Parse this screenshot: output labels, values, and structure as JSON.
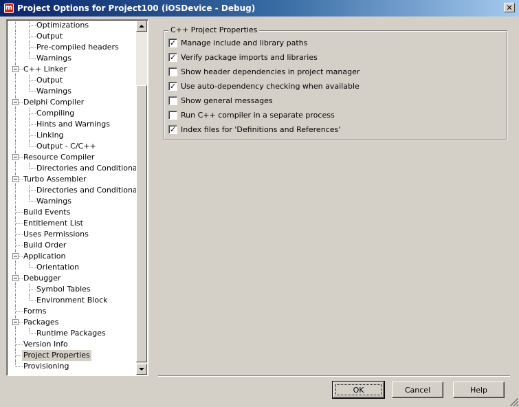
{
  "window": {
    "title": "Project Options for Project100  (iOSDevice - Debug)",
    "app_icon": "embarcadero-logo-icon",
    "close_glyph": "✕"
  },
  "tree": {
    "items": [
      {
        "label": "Optimizations",
        "level": 2,
        "expander": false
      },
      {
        "label": "Output",
        "level": 2,
        "expander": false
      },
      {
        "label": "Pre-compiled headers",
        "level": 2,
        "expander": false
      },
      {
        "label": "Warnings",
        "level": 2,
        "expander": false
      },
      {
        "label": "C++ Linker",
        "level": 1,
        "expander": true
      },
      {
        "label": "Output",
        "level": 2,
        "expander": false
      },
      {
        "label": "Warnings",
        "level": 2,
        "expander": false
      },
      {
        "label": "Delphi Compiler",
        "level": 1,
        "expander": true
      },
      {
        "label": "Compiling",
        "level": 2,
        "expander": false
      },
      {
        "label": "Hints and Warnings",
        "level": 2,
        "expander": false
      },
      {
        "label": "Linking",
        "level": 2,
        "expander": false
      },
      {
        "label": "Output - C/C++",
        "level": 2,
        "expander": false
      },
      {
        "label": "Resource Compiler",
        "level": 1,
        "expander": true
      },
      {
        "label": "Directories and Conditionals",
        "level": 2,
        "expander": false
      },
      {
        "label": "Turbo Assembler",
        "level": 1,
        "expander": true
      },
      {
        "label": "Directories and Conditionals",
        "level": 2,
        "expander": false
      },
      {
        "label": "Warnings",
        "level": 2,
        "expander": false
      },
      {
        "label": "Build Events",
        "level": 1,
        "expander": false
      },
      {
        "label": "Entitlement List",
        "level": 1,
        "expander": false
      },
      {
        "label": "Uses Permissions",
        "level": 1,
        "expander": false
      },
      {
        "label": "Build Order",
        "level": 1,
        "expander": false
      },
      {
        "label": "Application",
        "level": 1,
        "expander": true
      },
      {
        "label": "Orientation",
        "level": 2,
        "expander": false
      },
      {
        "label": "Debugger",
        "level": 1,
        "expander": true
      },
      {
        "label": "Symbol Tables",
        "level": 2,
        "expander": false
      },
      {
        "label": "Environment Block",
        "level": 2,
        "expander": false
      },
      {
        "label": "Forms",
        "level": 1,
        "expander": false
      },
      {
        "label": "Packages",
        "level": 1,
        "expander": true
      },
      {
        "label": "Runtime Packages",
        "level": 2,
        "expander": false
      },
      {
        "label": "Version Info",
        "level": 1,
        "expander": false
      },
      {
        "label": "Project Properties",
        "level": 1,
        "expander": false,
        "selected": true
      },
      {
        "label": "Provisioning",
        "level": 1,
        "expander": false
      }
    ]
  },
  "group": {
    "caption": "C++ Project Properties",
    "options": [
      {
        "label": "Manage include and library paths",
        "checked": true
      },
      {
        "label": "Verify package imports and libraries",
        "checked": true
      },
      {
        "label": "Show header dependencies in project manager",
        "checked": false
      },
      {
        "label": "Use auto-dependency checking when available",
        "checked": true
      },
      {
        "label": "Show general messages",
        "checked": false
      },
      {
        "label": "Run C++ compiler in a separate process",
        "checked": false
      },
      {
        "label": "Index files for 'Definitions and References'",
        "checked": true
      }
    ]
  },
  "buttons": {
    "ok": "OK",
    "cancel": "Cancel",
    "help": "Help"
  },
  "check_glyph": "✓"
}
